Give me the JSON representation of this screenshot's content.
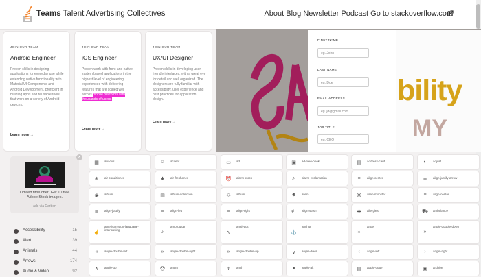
{
  "header": {
    "brand_prefix": "Teams",
    "brand_suffix": "Talent Advertising Collectives",
    "nav": "About Blog Newsletter Podcast Go to stackoverflow.com"
  },
  "jobs": [
    {
      "eyebrow": "JOIN OUR TEAM",
      "title": "Android Engineer",
      "desc": "Proven skills in designing applications for everyday use while extending native functionality with Material UI Components and Android Development, proficient in building apps and reusable tools that work on a variety of Android devices.",
      "highlight": "",
      "learn": "Learn more →"
    },
    {
      "eyebrow": "JOIN OUR TEAM",
      "title": "iOS Engineer",
      "desc": "Proven work with front and native system based applications in the highest level of engineering, experienced with delivering features that are scaled well across",
      "highlight": "mobile platforms with thousands of users.",
      "learn": "Learn more →"
    },
    {
      "eyebrow": "JOIN OUR TEAM",
      "title": "UX/UI Designer",
      "desc": "Proven skills in developing user friendly interfaces, with a great eye for detail and well organized. The designers are fully familiar with accessibility, user experience and best practices for application design.",
      "highlight": "",
      "learn": "Learn more →"
    }
  ],
  "banner": {
    "fields": [
      {
        "label": "FIRST NAME",
        "value": "eg. John"
      },
      {
        "label": "LAST NAME",
        "value": "eg. Doe"
      },
      {
        "label": "EMAIL ADDRESS",
        "value": "eg. jd@gmail.com"
      },
      {
        "label": "JOB TITLE",
        "value": "eg. CEO"
      }
    ],
    "art_text_top": "bility",
    "art_text_bottom": "MY"
  },
  "carbon": {
    "text": "Limited time offer: Get 10 free Adobe Stock images.",
    "via": "ads via Carbon",
    "close": "×"
  },
  "categories": [
    {
      "name": "Accessibility",
      "count": "15"
    },
    {
      "name": "Alert",
      "count": "39"
    },
    {
      "name": "Animals",
      "count": "44"
    },
    {
      "name": "Arrows",
      "count": "174"
    },
    {
      "name": "Audio & Video",
      "count": "92"
    }
  ],
  "tiles": [
    [
      "abacus",
      "accent",
      "ad",
      "ad-new-book",
      "address-card",
      "adjust"
    ],
    [
      "air-conditioner",
      "air-freshener",
      "alarm-clock",
      "alarm-exclamation",
      "align-center",
      "align-justify-arrow"
    ],
    [
      "album",
      "album-collection",
      "album",
      "alien",
      "alien-monster",
      "align-center"
    ],
    [
      "align-justify",
      "align-left",
      "align-right",
      "align-slash",
      "allergies",
      "ambulance"
    ],
    [
      "american-sign-language-interpreting",
      "amp-guitar",
      "analytics",
      "anchor",
      "angel",
      "angle-double-down"
    ],
    [
      "angle-double-left",
      "angle-double-right",
      "angle-double-up",
      "angle-down",
      "angle-left",
      "angle-right"
    ],
    [
      "angle-up",
      "angry",
      "ankh",
      "apple-alt",
      "apple-crate",
      "archive"
    ]
  ]
}
